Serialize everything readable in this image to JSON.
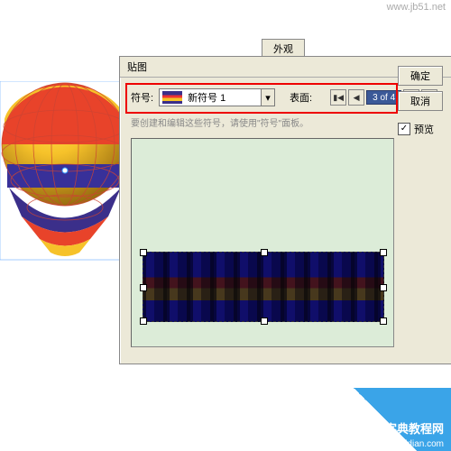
{
  "top_url": "www.jb51.net",
  "tabs": {
    "active": "贴图",
    "other": "外观"
  },
  "dialog": {
    "symbol_label": "符号:",
    "symbol_value": "新符号 1",
    "surface_label": "表面:",
    "page_indicator": "3 of 4",
    "hint": "要创建和编辑这些符号，请使用\"符号\"面板。",
    "ok": "确定",
    "cancel": "取消",
    "preview_label": "预览",
    "preview_checked": "✓"
  },
  "watermark": {
    "line1": "查字典教程网",
    "line2": "jiaocheng.chazidian.com"
  },
  "icons": {
    "first": "▮◀",
    "prev": "◀",
    "next": "▶",
    "last": "▶▮",
    "fast": "▶▶",
    "dd": "▾"
  }
}
